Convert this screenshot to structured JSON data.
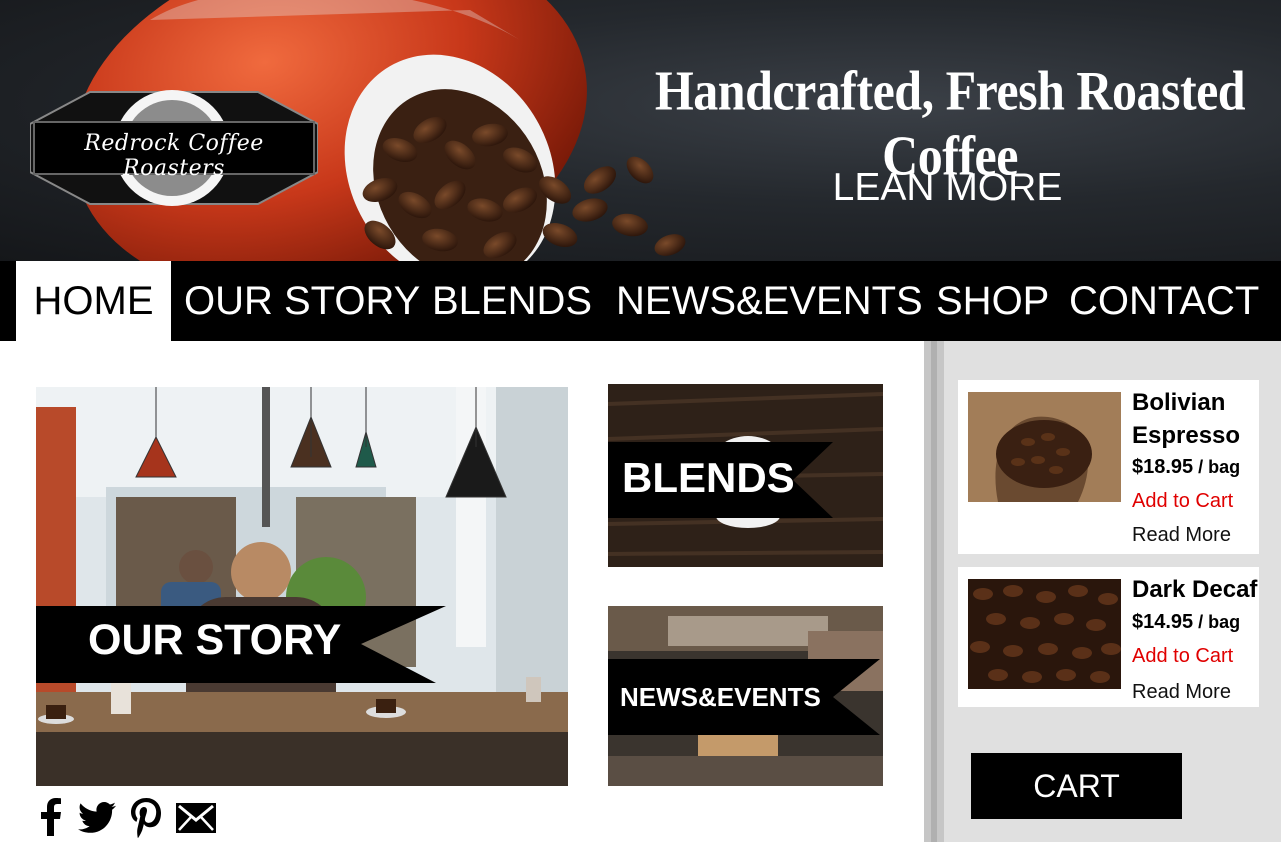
{
  "brand": {
    "logo_text": "Redrock Coffee Roasters"
  },
  "hero": {
    "tagline": "Handcrafted, Fresh Roasted Coffee",
    "cta_label": "LEAN MORE"
  },
  "nav": {
    "items": [
      {
        "label": "HOME",
        "active": true
      },
      {
        "label": "OUR STORY",
        "active": false
      },
      {
        "label": "BLENDS",
        "active": false
      },
      {
        "label": "NEWS&EVENTS",
        "active": false
      },
      {
        "label": "SHOP",
        "active": false
      },
      {
        "label": "CONTACT",
        "active": false
      }
    ]
  },
  "tiles": {
    "our_story": "OUR STORY",
    "blends": "BLENDS",
    "news_events": "NEWS&EVENTS"
  },
  "social": {
    "icons": [
      "facebook-icon",
      "twitter-icon",
      "pinterest-icon",
      "mail-icon"
    ]
  },
  "products": [
    {
      "name": "Bolivian Espresso",
      "price": "$18.95",
      "unit": " / bag",
      "add_label": "Add to Cart",
      "read_label": "Read More"
    },
    {
      "name": "Dark Decaf",
      "price": "$14.95",
      "unit": " / bag",
      "add_label": "Add to Cart",
      "read_label": "Read More"
    }
  ],
  "cart": {
    "label": "CART"
  },
  "colors": {
    "accent_red": "#e00000",
    "nav_bg": "#000000",
    "sidebar_bg": "#e0e0e0",
    "cup_red": "#c8381a"
  }
}
